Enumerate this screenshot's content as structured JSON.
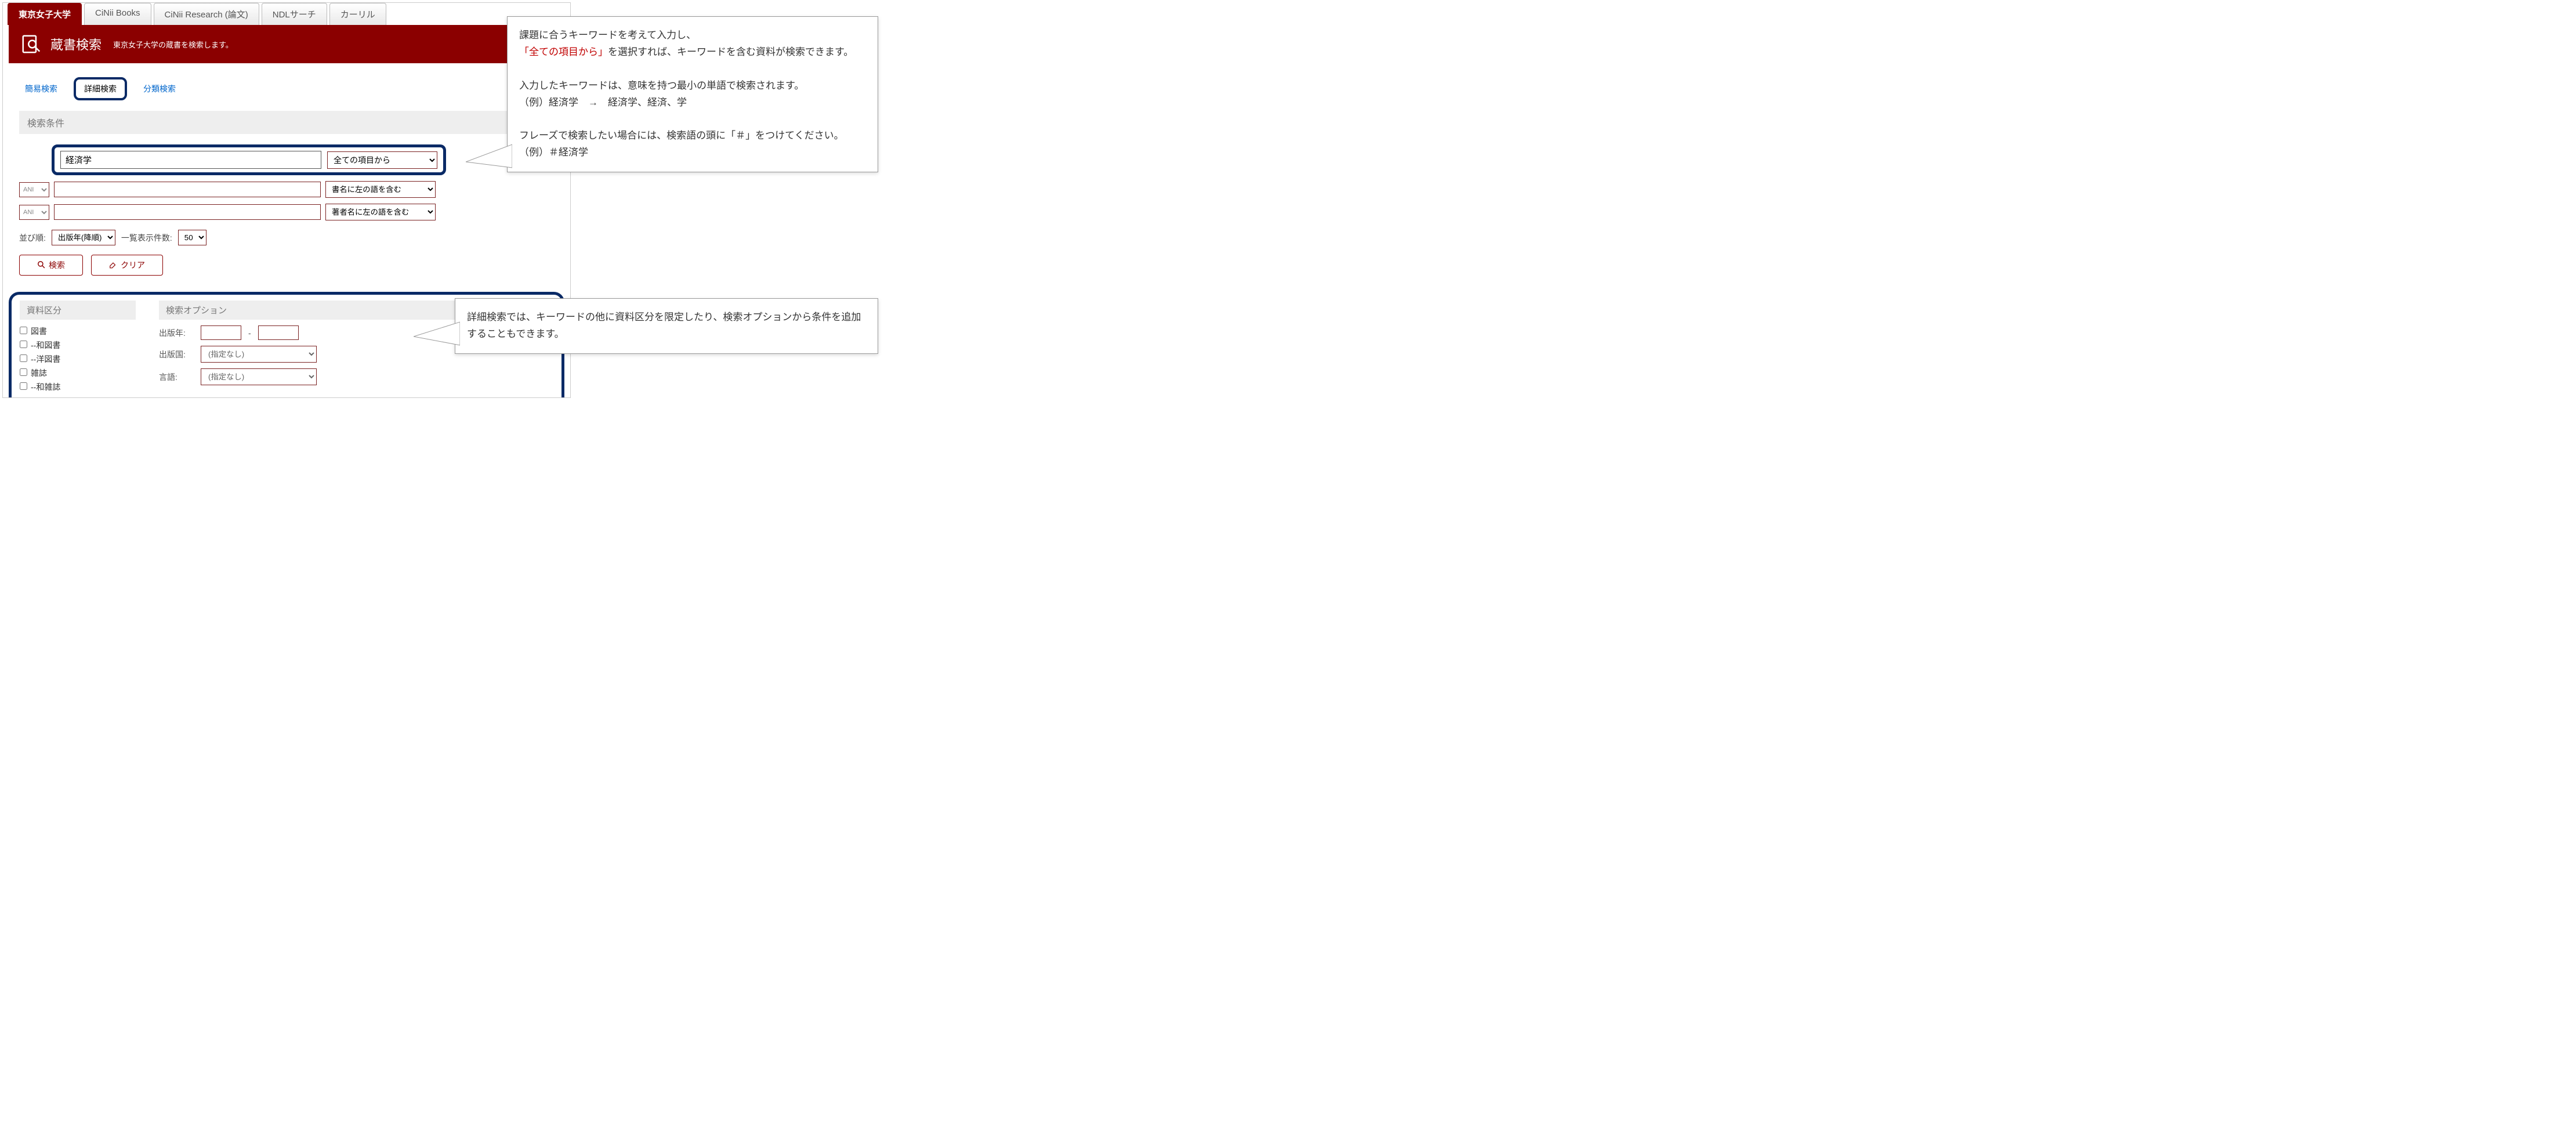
{
  "tabs": [
    "東京女子大学",
    "CiNii Books",
    "CiNii Research (論文)",
    "NDLサーチ",
    "カーリル"
  ],
  "banner": {
    "title": "蔵書検索",
    "subtitle": "東京女子大学の蔵書を検索します。"
  },
  "subnav": {
    "simple": "簡易検索",
    "detail": "詳細検索",
    "classify": "分類検索"
  },
  "section_label": "検索条件",
  "search": {
    "value": "経済学",
    "field": "全ての項目から"
  },
  "rows": [
    {
      "op": "ANI",
      "value": "",
      "field": "書名に左の語を含む"
    },
    {
      "op": "ANI",
      "value": "",
      "field": "著者名に左の語を含む"
    }
  ],
  "sort": {
    "label": "並び順:",
    "value": "出版年(降順)",
    "count_label": "一覧表示件数:",
    "count": "50"
  },
  "buttons": {
    "search": "検索",
    "clear": "クリア"
  },
  "bottom": {
    "left_head": "資料区分",
    "right_head": "検索オプション",
    "checks": [
      "図書",
      "--和図書",
      "--洋図書",
      "雑誌",
      "--和雑誌"
    ],
    "year_label": "出版年:",
    "country_label": "出版国:",
    "lang_label": "言語:",
    "none": "(指定なし)"
  },
  "callout1": {
    "l1": "課題に合うキーワードを考えて入力し、",
    "l2a": "「全ての項目から」",
    "l2b": "を選択すれば、キーワードを含む資料が検索できます。",
    "l3": "入力したキーワードは、意味を持つ最小の単語で検索されます。",
    "l4": "（例）経済学　→　経済学、経済、学",
    "l5": "フレーズで検索したい場合には、検索語の頭に「＃」をつけてください。",
    "l6": "（例）＃経済学"
  },
  "callout2": {
    "text": "詳細検索では、キーワードの他に資料区分を限定したり、検索オプションから条件を追加することもできます。"
  }
}
